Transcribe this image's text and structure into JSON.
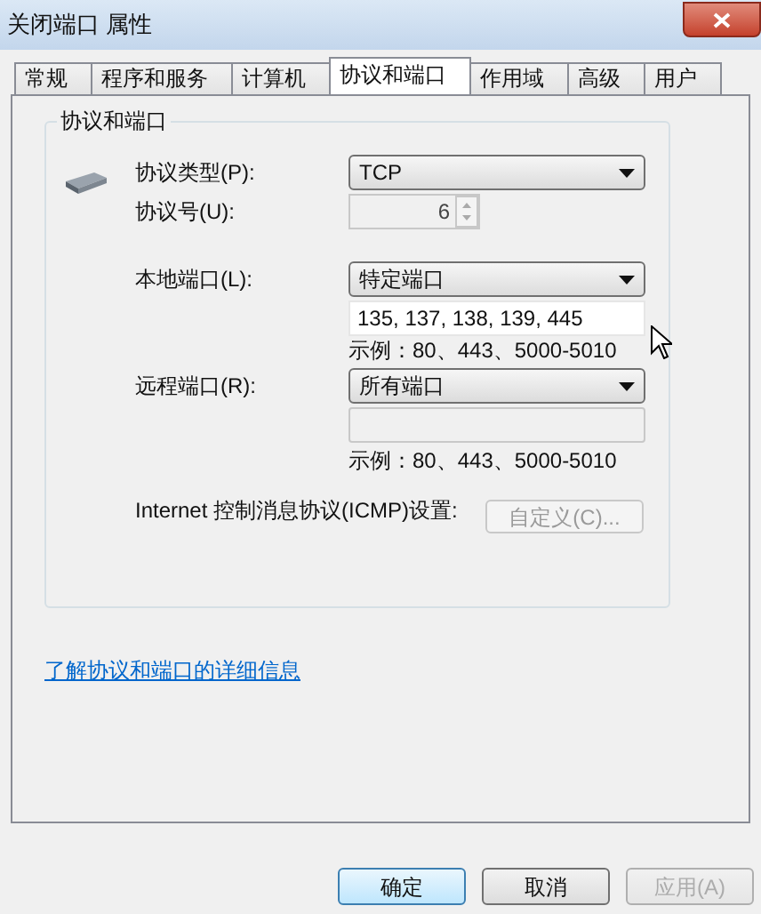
{
  "window": {
    "title": "关闭端口 属性"
  },
  "tabs": [
    {
      "label": "常规",
      "selected": false
    },
    {
      "label": "程序和服务",
      "selected": false
    },
    {
      "label": "计算机",
      "selected": false
    },
    {
      "label": "协议和端口",
      "selected": true
    },
    {
      "label": "作用域",
      "selected": false
    },
    {
      "label": "高级",
      "selected": false
    },
    {
      "label": "用户",
      "selected": false
    }
  ],
  "group": {
    "title": "协议和端口",
    "protocol_type": {
      "label": "协议类型(P):",
      "value": "TCP"
    },
    "protocol_number": {
      "label": "协议号(U):",
      "value": "6",
      "disabled": true
    },
    "local_port": {
      "label": "本地端口(L):",
      "value": "特定端口",
      "ports": "135, 137, 138, 139, 445",
      "ports_disabled": false,
      "example": "示例：80、443、5000-5010"
    },
    "remote_port": {
      "label": "远程端口(R):",
      "value": "所有端口",
      "ports_disabled": true,
      "example": "示例：80、443、5000-5010"
    },
    "icmp": {
      "label": "Internet 控制消息协议(ICMP)设置:",
      "button": "自定义(C)...",
      "disabled": true
    }
  },
  "link": "了解协议和端口的详细信息",
  "buttons": [
    {
      "label": "确定",
      "disabled": false,
      "default": true
    },
    {
      "label": "取消",
      "disabled": false,
      "default": false
    },
    {
      "label": "应用(A)",
      "disabled": true,
      "default": false
    }
  ]
}
